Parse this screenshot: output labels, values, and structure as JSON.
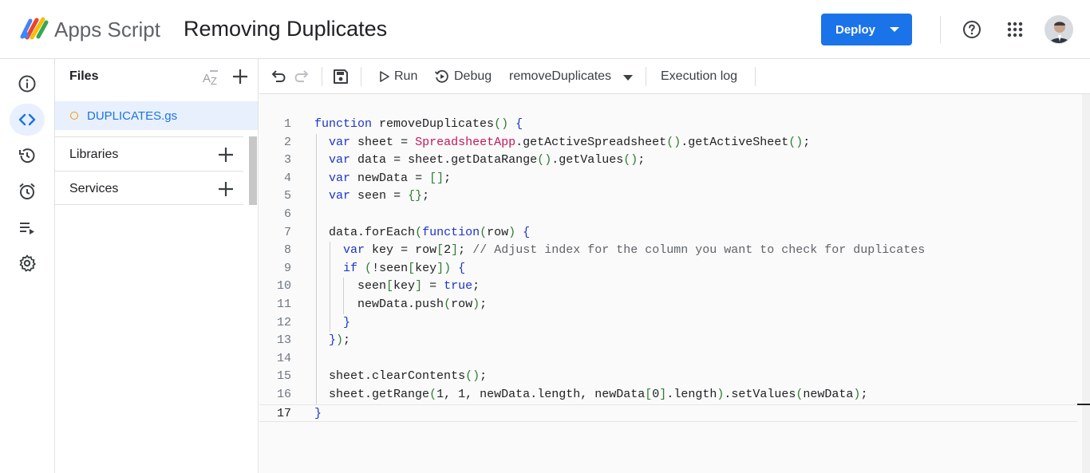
{
  "header": {
    "app_name": "Apps Script",
    "project_title": "Removing Duplicates",
    "deploy_label": "Deploy"
  },
  "files": {
    "title": "Files",
    "items": [
      {
        "name": "DUPLICATES.gs"
      }
    ],
    "sections": [
      {
        "label": "Libraries"
      },
      {
        "label": "Services"
      }
    ]
  },
  "toolbar": {
    "run_label": "Run",
    "debug_label": "Debug",
    "function_select": "removeDuplicates",
    "execution_log_label": "Execution log"
  },
  "editor": {
    "current_line": 17,
    "line_numbers": [
      "1",
      "2",
      "3",
      "4",
      "5",
      "6",
      "7",
      "8",
      "9",
      "10",
      "11",
      "12",
      "13",
      "14",
      "15",
      "16",
      "17"
    ],
    "lines": [
      "function removeDuplicates() {",
      "  var sheet = SpreadsheetApp.getActiveSpreadsheet().getActiveSheet();",
      "  var data = sheet.getDataRange().getValues();",
      "  var newData = [];",
      "  var seen = {};",
      "",
      "  data.forEach(function(row) {",
      "    var key = row[2]; // Adjust index for the column you want to check for duplicates",
      "    if (!seen[key]) {",
      "      seen[key] = true;",
      "      newData.push(row);",
      "    }",
      "  });",
      "",
      "  sheet.clearContents();",
      "  sheet.getRange(1, 1, newData.length, newData[0].length).setValues(newData);",
      "}"
    ]
  },
  "colors": {
    "accent": "#1a73e8",
    "keyword": "#1a35c8",
    "class_name": "#c2185b",
    "punctuation": "#2e7d32",
    "file_dot": "#f29900"
  },
  "icons": {
    "rail": [
      "info-icon",
      "code-icon",
      "history-icon",
      "alarm-icon",
      "executions-icon",
      "settings-icon"
    ],
    "toolbar": [
      "undo-icon",
      "redo-icon",
      "save-icon",
      "play-icon",
      "debug-icon"
    ]
  }
}
